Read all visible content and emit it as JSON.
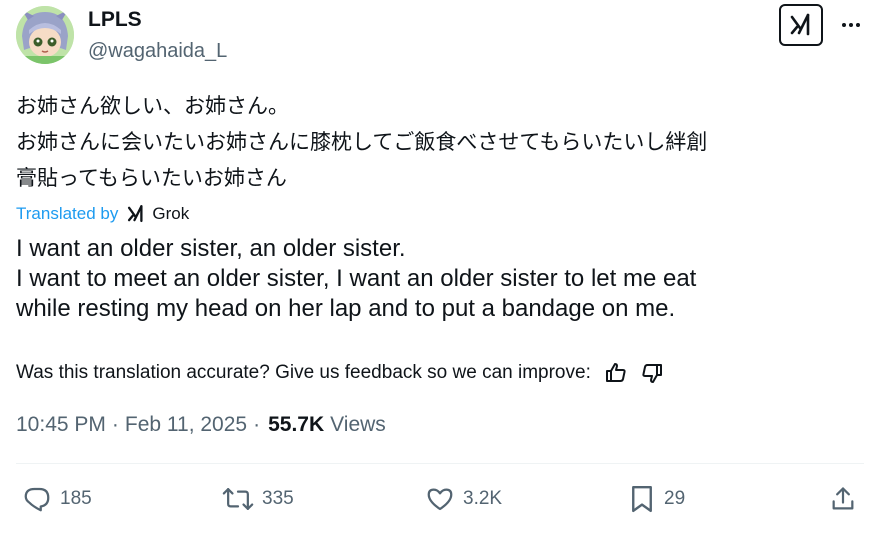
{
  "author": {
    "display_name": "LPLS",
    "handle": "@wagahaida_L"
  },
  "post": {
    "original_text": "お姉さん欲しい、お姉さん。\nお姉さんに会いたいお姉さんに膝枕してご飯食べさせてもらいたいし絆創\n膏貼ってもらいたいお姉さん",
    "translated_by_label": "Translated by",
    "translator_name": "Grok",
    "translated_text": "I want an older sister, an older sister.\nI want to meet an older sister, I want an older sister to let me eat\nwhile resting my head on her lap and to put a bandage on me.",
    "feedback_prompt": "Was this translation accurate? Give us feedback so we can improve:",
    "time": "10:45 PM",
    "separator_dot": "·",
    "date": "Feb 11, 2025",
    "views_count": "55.7K",
    "views_label": "Views"
  },
  "actions": {
    "replies": "185",
    "reposts": "335",
    "likes": "3.2K",
    "bookmarks": "29"
  },
  "icons": {
    "top_right": [
      "grok-icon",
      "more-icon"
    ],
    "feedback": [
      "thumbs-up-icon",
      "thumbs-down-icon"
    ],
    "action_bar": [
      "reply-icon",
      "repost-icon",
      "like-icon",
      "bookmark-icon",
      "share-icon"
    ]
  },
  "colors": {
    "text": "#0f1419",
    "secondary": "#536471",
    "accent": "#1d9bf0",
    "divider": "#eff3f4"
  }
}
